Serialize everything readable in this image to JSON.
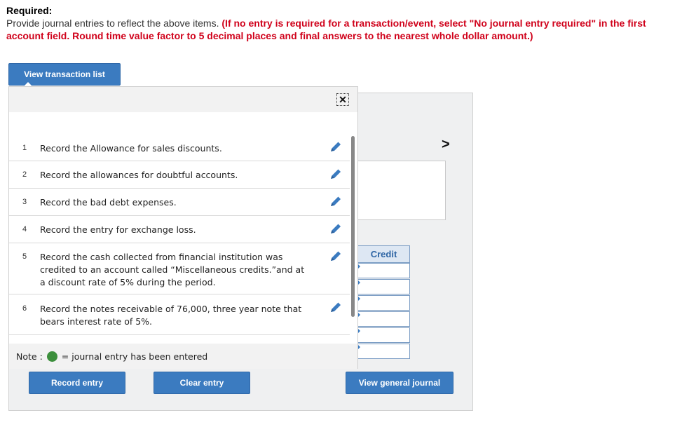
{
  "header": {
    "title": "Required:",
    "instruction_plain": "Provide journal entries to reflect the above items. ",
    "instruction_red": "(If no entry is required for a transaction/event, select \"No journal entry required\" in the first account field. Round time value factor to 5 decimal places and final answers to the nearest whole dollar amount.)"
  },
  "buttons": {
    "view_transaction_list": "View transaction list",
    "record_entry": "Record entry",
    "clear_entry": "Clear entry",
    "view_general_journal": "View general journal"
  },
  "popup": {
    "close_glyph": "✕",
    "items": [
      {
        "num": "1",
        "text": "Record the Allowance for sales discounts."
      },
      {
        "num": "2",
        "text": "Record the allowances for doubtful accounts."
      },
      {
        "num": "3",
        "text": "Record the bad debt expenses."
      },
      {
        "num": "4",
        "text": "Record the entry for exchange loss."
      },
      {
        "num": "5",
        "text": "Record the cash collected from financial institution was credited to an account called “Miscellaneous credits.”and at a discount rate of 5% during the period."
      },
      {
        "num": "6",
        "text": "Record the notes receivable of 76,000, three year note that bears interest rate of 5%."
      }
    ],
    "note_label": "Note :",
    "note_text": "= journal entry has been entered"
  },
  "journal": {
    "credit_header": "Credit",
    "next_glyph": ">"
  },
  "colors": {
    "accent": "#3b7bc0",
    "instruction_red": "#d0021b",
    "entered_dot": "#3c8f3c"
  },
  "icons": [
    "pencil-icon",
    "close-icon",
    "chevron-right-icon"
  ]
}
